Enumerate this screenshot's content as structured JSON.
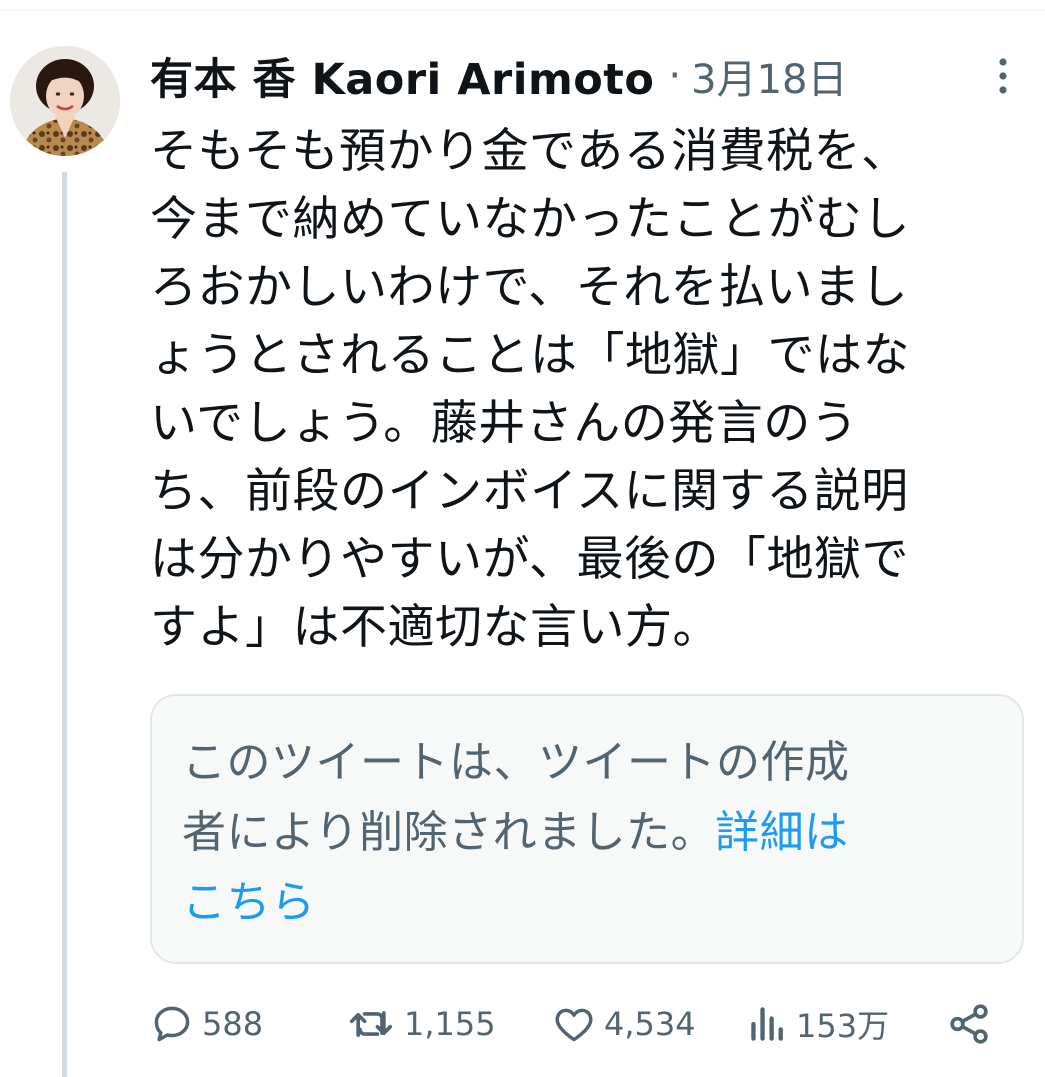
{
  "tweet": {
    "author_display_name": "有本 香 Kaori Arimoto",
    "separator": "·",
    "date": "3月18日",
    "text_lines": [
      "そもそも預かり金である消費税を、",
      "今まで納めていなかったことがむし",
      "ろおかしいわけで、それを払いまし",
      "ょうとされることは「地獄」ではな",
      "いでしょう。藤井さんの発言のう",
      "ち、前段のインボイスに関する説明",
      "は分かりやすいが、最後の「地獄で",
      "すよ」は不適切な言い方。"
    ]
  },
  "quoted": {
    "line1": "このツイートは、ツイートの作成",
    "line2": "者により削除されました。",
    "learn_more_part1": "詳細は",
    "learn_more_part2": "こちら"
  },
  "actions": {
    "replies": "588",
    "retweets": "1,155",
    "likes": "4,534",
    "views": "153万"
  },
  "icons": [
    "more-icon",
    "reply-icon",
    "retweet-icon",
    "like-icon",
    "views-icon",
    "share-icon"
  ],
  "colors": {
    "text_primary": "#0f1419",
    "text_secondary": "#536471",
    "link": "#1d9bf0",
    "thread_line": "#cfd9de",
    "quote_bg": "#f7f9f9"
  }
}
